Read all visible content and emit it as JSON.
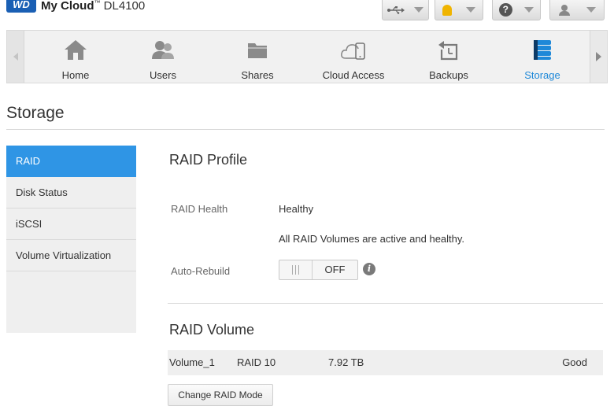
{
  "header": {
    "logo_text": "WD",
    "product_name": "My Cloud",
    "trademark": "™",
    "model": "DL4100",
    "accent_color": "#1a5fb4",
    "toolbar": [
      {
        "icon": "usb-icon"
      },
      {
        "icon": "alert-bell-icon"
      },
      {
        "icon": "help-icon",
        "glyph": "?"
      },
      {
        "icon": "user-icon"
      }
    ]
  },
  "nav": {
    "items": [
      {
        "label": "Home",
        "icon": "home-icon"
      },
      {
        "label": "Users",
        "icon": "users-icon"
      },
      {
        "label": "Shares",
        "icon": "folder-icon"
      },
      {
        "label": "Cloud Access",
        "icon": "cloud-device-icon"
      },
      {
        "label": "Backups",
        "icon": "backup-icon"
      },
      {
        "label": "Storage",
        "icon": "storage-icon",
        "active": true
      }
    ],
    "active_color": "#1e88d8"
  },
  "page": {
    "title": "Storage"
  },
  "sidebar": {
    "items": [
      {
        "label": "RAID",
        "active": true
      },
      {
        "label": "Disk Status"
      },
      {
        "label": "iSCSI"
      },
      {
        "label": "Volume Virtualization"
      }
    ],
    "active_color": "#2f95e5"
  },
  "raid_profile": {
    "title": "RAID Profile",
    "health_label": "RAID Health",
    "health_value": "Healthy",
    "health_message": "All RAID Volumes are active and healthy.",
    "auto_rebuild_label": "Auto-Rebuild",
    "auto_rebuild_state": "OFF",
    "info_glyph": "i"
  },
  "raid_volume": {
    "title": "RAID Volume",
    "rows": [
      {
        "name": "Volume_1",
        "raid_level": "RAID 10",
        "size": "7.92 TB",
        "status": "Good"
      }
    ],
    "change_button": "Change RAID Mode"
  }
}
